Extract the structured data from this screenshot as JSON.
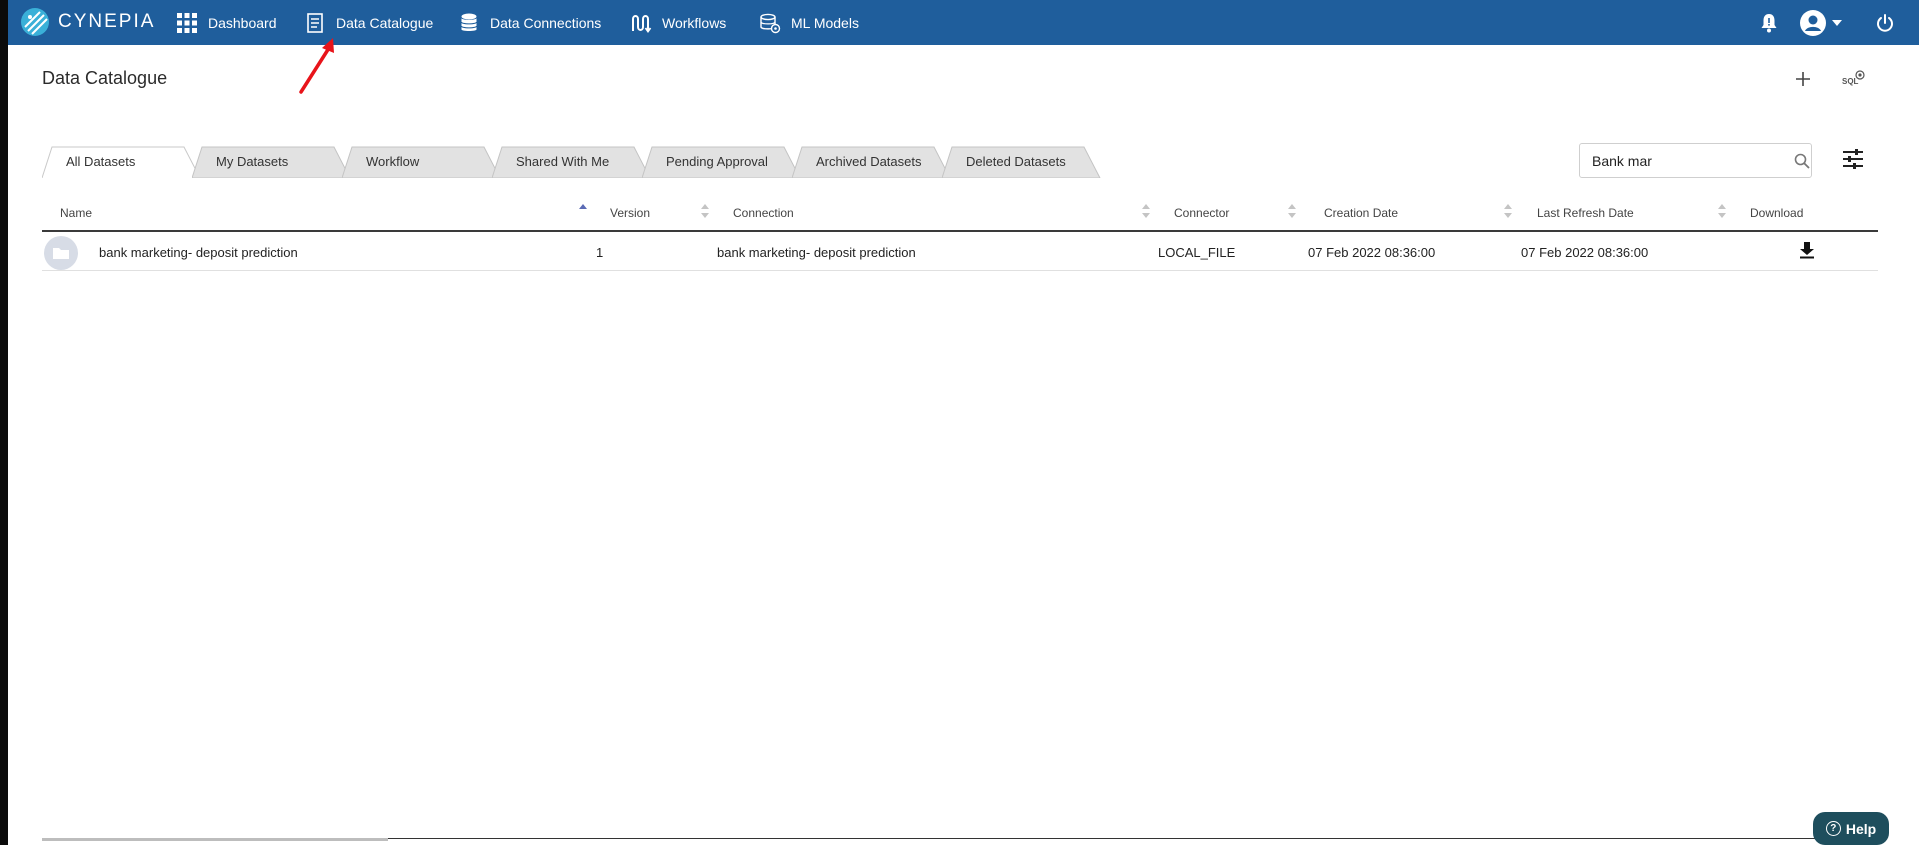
{
  "app": {
    "brand": "CYNEPIA"
  },
  "nav": {
    "items": [
      {
        "label": "Dashboard",
        "icon": "grid-icon"
      },
      {
        "label": "Data Catalogue",
        "icon": "document-icon"
      },
      {
        "label": "Data Connections",
        "icon": "database-icon"
      },
      {
        "label": "Workflows",
        "icon": "workflow-icon"
      },
      {
        "label": "ML Models",
        "icon": "ml-models-icon"
      }
    ],
    "right_icons": [
      "bell-icon",
      "user-avatar-icon",
      "chevron-down-icon",
      "power-icon"
    ]
  },
  "page": {
    "title": "Data Catalogue",
    "add_icon": "plus-icon",
    "sql_label": "SQL"
  },
  "tabs": [
    {
      "label": "All Datasets",
      "active": true
    },
    {
      "label": "My Datasets",
      "active": false
    },
    {
      "label": "Workflow",
      "active": false
    },
    {
      "label": "Shared With Me",
      "active": false
    },
    {
      "label": "Pending Approval",
      "active": false
    },
    {
      "label": "Archived Datasets",
      "active": false
    },
    {
      "label": "Deleted Datasets",
      "active": false
    }
  ],
  "search": {
    "value": "Bank mar",
    "placeholder": ""
  },
  "table": {
    "columns": [
      "Name",
      "Version",
      "Connection",
      "Connector",
      "Creation Date",
      "Last Refresh Date",
      "Download"
    ],
    "rows": [
      {
        "name": "bank marketing- deposit prediction",
        "version": "1",
        "connection": "bank marketing- deposit prediction",
        "connector": "LOCAL_FILE",
        "creation_date": "07 Feb 2022 08:36:00",
        "last_refresh_date": "07 Feb 2022 08:36:00"
      }
    ]
  },
  "help": {
    "label": "Help"
  },
  "colors": {
    "nav_bg": "#1f5e9c",
    "help_bg": "#1e4e5d",
    "annotation": "#e8141a",
    "sort_active": "#5b6bb5"
  }
}
